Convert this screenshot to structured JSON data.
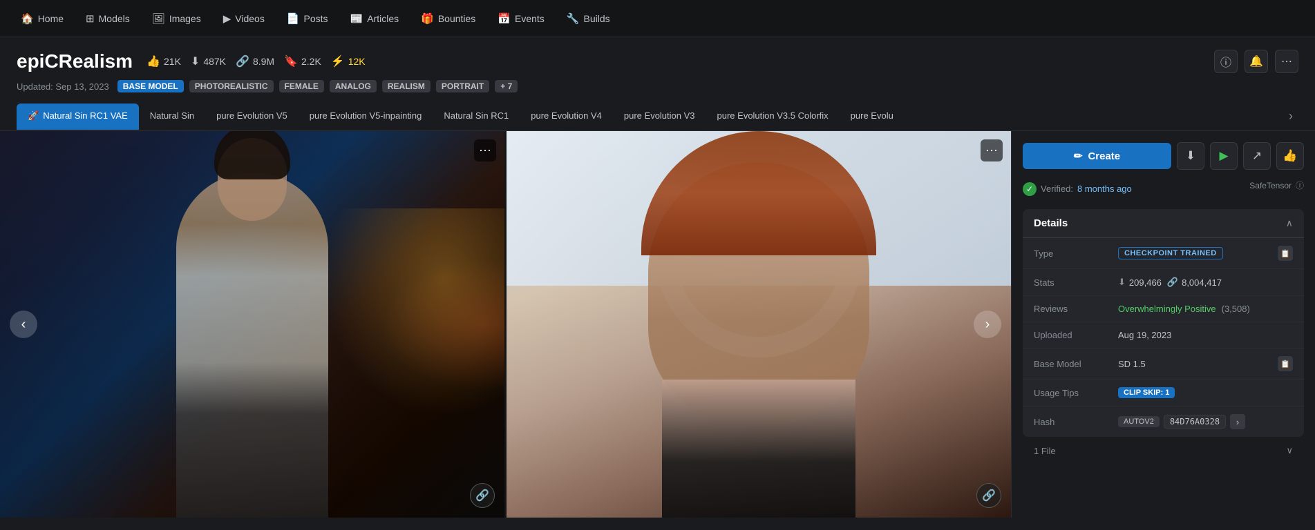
{
  "nav": {
    "items": [
      {
        "label": "Home",
        "icon": "🏠",
        "name": "home"
      },
      {
        "label": "Models",
        "icon": "⊞",
        "name": "models"
      },
      {
        "label": "Images",
        "icon": "🖼",
        "name": "images"
      },
      {
        "label": "Videos",
        "icon": "▶",
        "name": "videos"
      },
      {
        "label": "Posts",
        "icon": "📄",
        "name": "posts"
      },
      {
        "label": "Articles",
        "icon": "📰",
        "name": "articles"
      },
      {
        "label": "Bounties",
        "icon": "🎁",
        "name": "bounties"
      },
      {
        "label": "Events",
        "icon": "📅",
        "name": "events"
      },
      {
        "label": "Builds",
        "icon": "🔧",
        "name": "builds"
      }
    ]
  },
  "model": {
    "title": "epiCRealism",
    "updated_label": "Updated: Sep 13, 2023",
    "stats": {
      "likes": "21K",
      "downloads": "487K",
      "links": "8.9M",
      "bookmarks": "2.2K",
      "buzz": "12K"
    },
    "tags": [
      {
        "label": "BASE MODEL",
        "style": "blue"
      },
      {
        "label": "PHOTOREALISTIC",
        "style": "gray"
      },
      {
        "label": "FEMALE",
        "style": "gray"
      },
      {
        "label": "ANALOG",
        "style": "gray"
      },
      {
        "label": "REALISM",
        "style": "gray"
      },
      {
        "label": "PORTRAIT",
        "style": "gray"
      },
      {
        "label": "+ 7",
        "style": "more"
      }
    ]
  },
  "versions": {
    "tabs": [
      {
        "label": "Natural Sin RC1 VAE",
        "active": true,
        "rocket": true
      },
      {
        "label": "Natural Sin"
      },
      {
        "label": "pure Evolution V5"
      },
      {
        "label": "pure Evolution V5-inpainting"
      },
      {
        "label": "Natural Sin RC1"
      },
      {
        "label": "pure Evolution V4"
      },
      {
        "label": "pure Evolution V3"
      },
      {
        "label": "pure Evolution V3.5 Colorfix"
      },
      {
        "label": "pure Evolu"
      }
    ]
  },
  "gallery": {
    "prev_label": "‹",
    "next_label": "›",
    "more_options": "⋯",
    "link_icon": "🔗"
  },
  "sidebar": {
    "create_label": "Create",
    "create_icon": "✏",
    "download_icon": "⬇",
    "play_icon": "▶",
    "share_icon": "↗",
    "like_icon": "👍",
    "verified_text": "Verified:",
    "verified_date": "8 months ago",
    "safetensor_label": "SafeTensor",
    "info_icon": "ⓘ",
    "details": {
      "title": "Details",
      "chevron": "∧",
      "rows": [
        {
          "label": "Type",
          "value_type": "badge",
          "badge_label": "CHECKPOINT TRAINED",
          "copy_icon": true
        },
        {
          "label": "Stats",
          "value_type": "stats",
          "downloads": "209,466",
          "links": "8,004,417"
        },
        {
          "label": "Reviews",
          "value_type": "reviews",
          "sentiment": "Overwhelmingly Positive",
          "count": "(3,508)"
        },
        {
          "label": "Uploaded",
          "value_type": "text",
          "value": "Aug 19, 2023"
        },
        {
          "label": "Base Model",
          "value_type": "base_model",
          "value": "SD 1.5",
          "copy_icon": true
        },
        {
          "label": "Usage Tips",
          "value_type": "clip_skip",
          "badge_label": "CLIP SKIP: 1"
        },
        {
          "label": "Hash",
          "value_type": "hash",
          "hash_type": "AUTOV2",
          "hash_value": "84D76A0328"
        }
      ]
    },
    "files_label": "1 File"
  }
}
